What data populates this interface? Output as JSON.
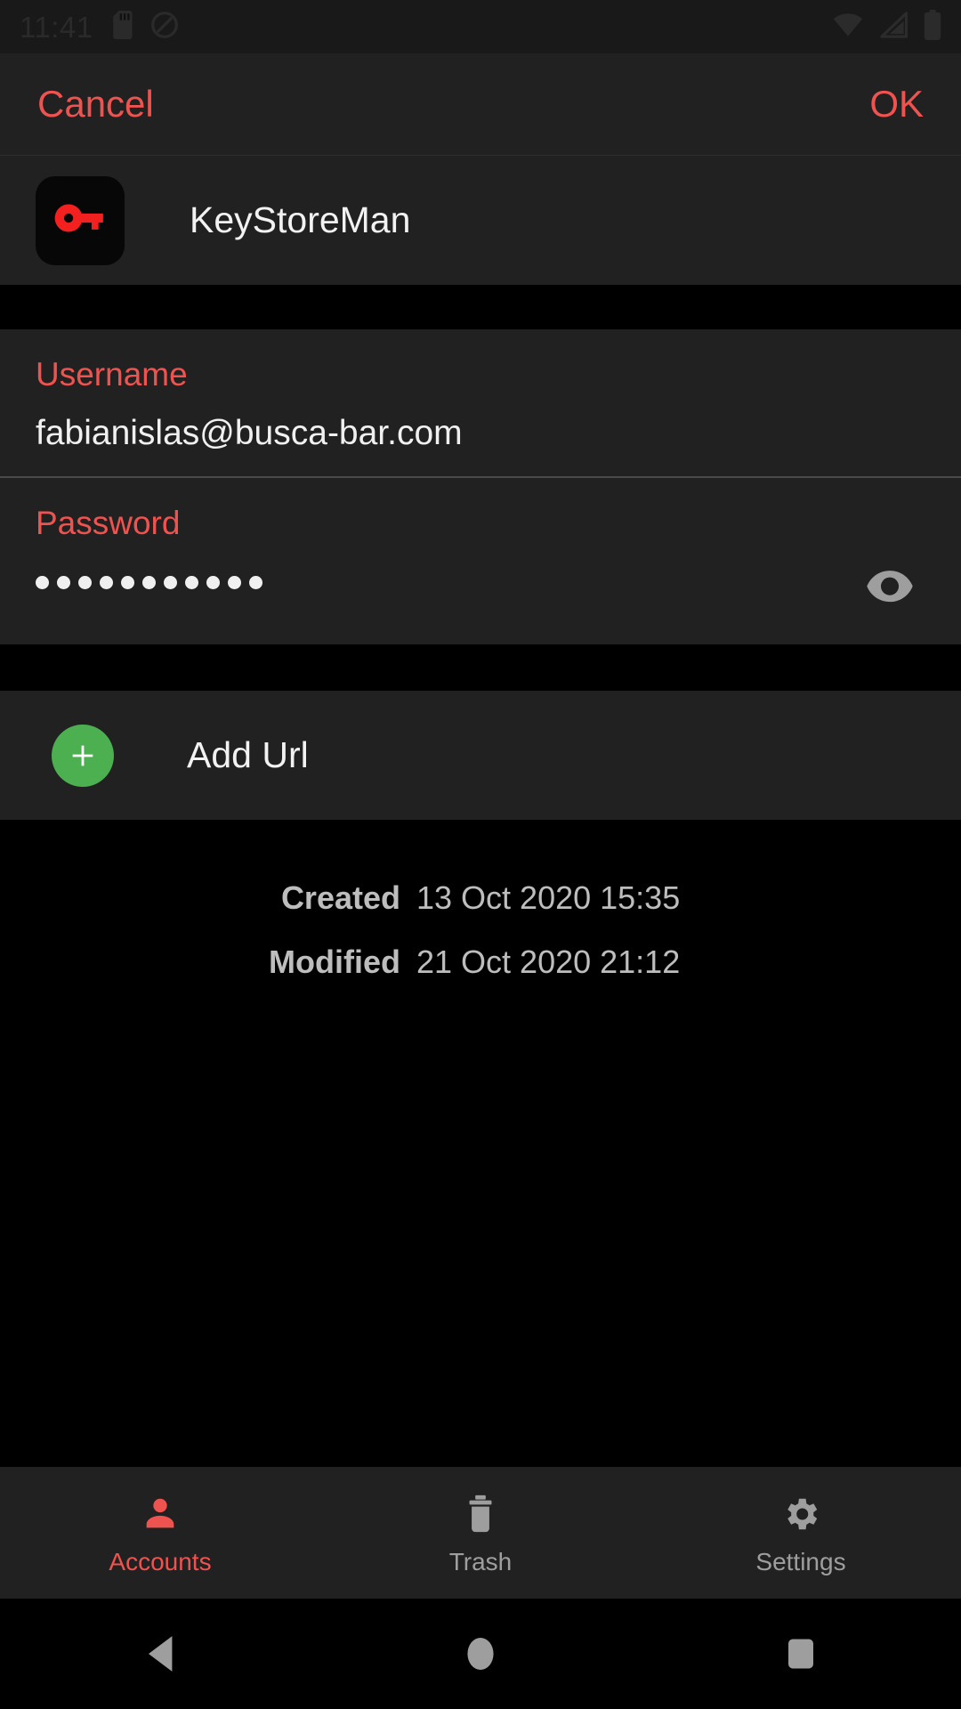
{
  "status_bar": {
    "clock": "11:41",
    "left_icons": [
      "sd-card-icon",
      "do-not-disturb-icon"
    ],
    "right_icons": [
      "wifi-icon",
      "cell-signal-icon",
      "battery-icon"
    ]
  },
  "action_bar": {
    "cancel_label": "Cancel",
    "ok_label": "OK",
    "accent_color": "#ef5350"
  },
  "app_header": {
    "title": "KeyStoreMan",
    "icon": "key-icon",
    "icon_color": "#f32020",
    "icon_bg": "#070707"
  },
  "fields": {
    "username": {
      "label": "Username",
      "value": "fabianislas@busca-bar.com"
    },
    "password": {
      "label": "Password",
      "masked_value": "•••••••••••",
      "dot_count": 11,
      "toggle_icon": "eye-icon"
    }
  },
  "add_url": {
    "label": "Add Url",
    "button_icon": "plus-icon",
    "button_color": "#4caf50"
  },
  "meta": [
    {
      "label": "Created",
      "value": "13 Oct 2020 15:35"
    },
    {
      "label": "Modified",
      "value": "21 Oct 2020 21:12"
    }
  ],
  "tabbar": {
    "tabs": [
      {
        "label": "Accounts",
        "icon": "person-icon",
        "active": true
      },
      {
        "label": "Trash",
        "icon": "trash-icon",
        "active": false
      },
      {
        "label": "Settings",
        "icon": "gear-icon",
        "active": false
      }
    ],
    "active_color": "#ef5350",
    "inactive_color": "#9e9e9e"
  },
  "navbar": {
    "buttons": [
      "back-triangle-icon",
      "home-circle-icon",
      "recents-square-icon"
    ],
    "color": "#9e9e9e"
  }
}
